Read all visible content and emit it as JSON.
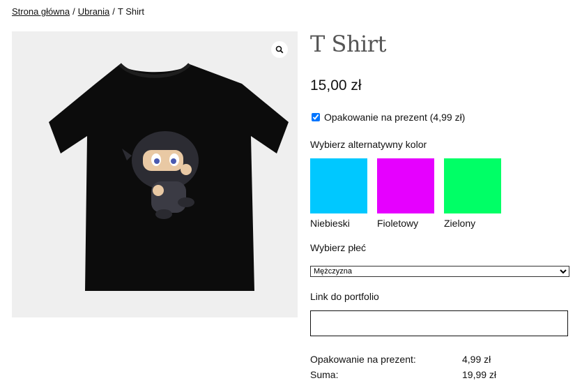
{
  "breadcrumb": {
    "home": "Strona główna",
    "category": "Ubrania",
    "current": "T Shirt",
    "separator": "/"
  },
  "product": {
    "title": "T Shirt",
    "price": "15,00 zł",
    "image_alt": "T Shirt"
  },
  "gift_wrap": {
    "label": "Opakowanie na prezent (4,99 zł)",
    "checked": true
  },
  "color_picker": {
    "label": "Wybierz alternatywny kolor",
    "options": [
      {
        "name": "Niebieski",
        "color": "#00c8ff"
      },
      {
        "name": "Fioletowy",
        "color": "#e600ff"
      },
      {
        "name": "Zielony",
        "color": "#00ff66"
      }
    ]
  },
  "gender": {
    "label": "Wybierz płeć",
    "selected": "Mężczyzna"
  },
  "portfolio": {
    "label": "Link do portfolio",
    "value": ""
  },
  "totals": [
    {
      "label": "Opakowanie na prezent:",
      "value": "4,99 zł"
    },
    {
      "label": "Suma:",
      "value": "19,99 zł"
    }
  ]
}
